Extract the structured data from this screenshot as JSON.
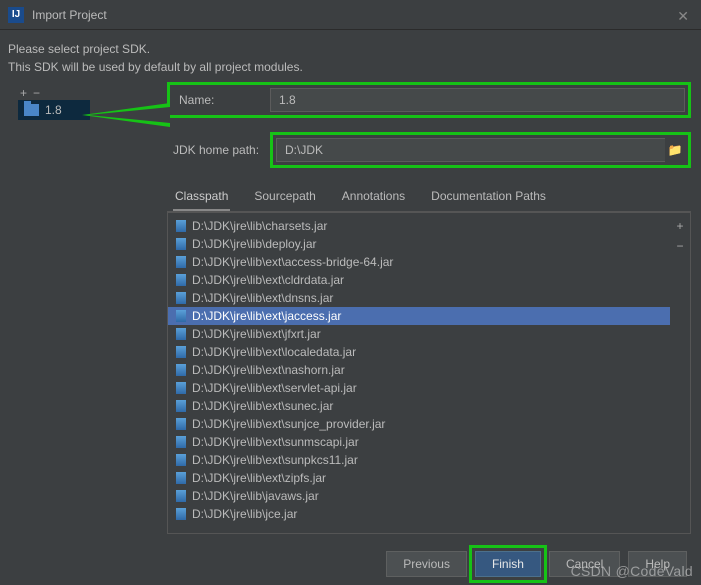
{
  "window": {
    "title": "Import Project"
  },
  "instructions": {
    "line1": "Please select project SDK.",
    "line2": "This SDK will be used by default by all project modules."
  },
  "toolbar": {
    "add": "+",
    "remove": "−"
  },
  "sdk_tree": {
    "items": [
      {
        "label": "1.8"
      }
    ]
  },
  "fields": {
    "name_label": "Name:",
    "name_value": "1.8",
    "jdk_path_label": "JDK home path:",
    "jdk_path_value": "D:\\JDK"
  },
  "tabs": {
    "classpath": "Classpath",
    "sourcepath": "Sourcepath",
    "annotations": "Annotations",
    "docs": "Documentation Paths"
  },
  "classpath": {
    "items": [
      "D:\\JDK\\jre\\lib\\charsets.jar",
      "D:\\JDK\\jre\\lib\\deploy.jar",
      "D:\\JDK\\jre\\lib\\ext\\access-bridge-64.jar",
      "D:\\JDK\\jre\\lib\\ext\\cldrdata.jar",
      "D:\\JDK\\jre\\lib\\ext\\dnsns.jar",
      "D:\\JDK\\jre\\lib\\ext\\jaccess.jar",
      "D:\\JDK\\jre\\lib\\ext\\jfxrt.jar",
      "D:\\JDK\\jre\\lib\\ext\\localedata.jar",
      "D:\\JDK\\jre\\lib\\ext\\nashorn.jar",
      "D:\\JDK\\jre\\lib\\ext\\servlet-api.jar",
      "D:\\JDK\\jre\\lib\\ext\\sunec.jar",
      "D:\\JDK\\jre\\lib\\ext\\sunjce_provider.jar",
      "D:\\JDK\\jre\\lib\\ext\\sunmscapi.jar",
      "D:\\JDK\\jre\\lib\\ext\\sunpkcs11.jar",
      "D:\\JDK\\jre\\lib\\ext\\zipfs.jar",
      "D:\\JDK\\jre\\lib\\javaws.jar",
      "D:\\JDK\\jre\\lib\\jce.jar"
    ],
    "selected_index": 5
  },
  "list_side": {
    "add": "+",
    "remove": "−"
  },
  "footer": {
    "previous": "Previous",
    "finish": "Finish",
    "cancel": "Cancel",
    "help": "Help"
  },
  "watermark": "CSDN @CodeVald"
}
